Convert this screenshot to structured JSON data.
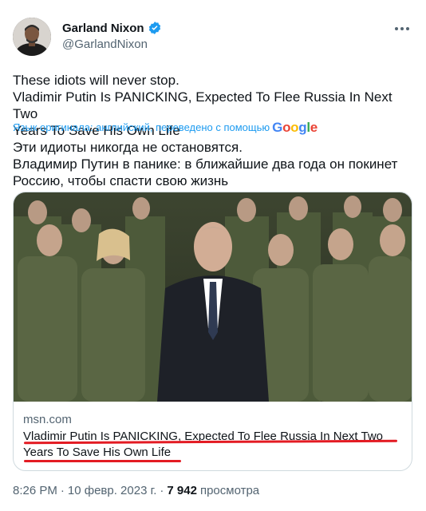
{
  "author": {
    "name": "Garland Nixon",
    "handle": "@GarlandNixon"
  },
  "tweet": {
    "text_line1": "These idiots will never stop.",
    "text_line2": "Vladimir Putin Is PANICKING, Expected To Flee Russia In Next Two",
    "text_line3": "Years To Save His Own Life",
    "translation_note": "Язык оригинала: английский, переведено с помощью",
    "translation_provider": [
      "G",
      "o",
      "o",
      "g",
      "l",
      "e"
    ],
    "translated_line1": "Эти идиоты никогда не остановятся.",
    "translated_line2": "Владимир Путин в панике: в ближайшие два года он покинет",
    "translated_line3": "Россию, чтобы спасти свою жизнь"
  },
  "card": {
    "domain": "msn.com",
    "title_line1": "Vladimir Putin Is PANICKING, Expected To Flee Russia In Next Two",
    "title_line2": "Years To Save His Own Life",
    "image_icon": "news-photo-icon"
  },
  "meta": {
    "time": "8:26 PM",
    "separator1": "·",
    "date": "10 февр. 2023 г.",
    "separator2": "·",
    "views_count": "7 942",
    "views_label": "просмотра"
  },
  "colors": {
    "link_blue": "#1d9bf0",
    "secondary_text": "#536471",
    "primary_text": "#0f1419",
    "annotation_red": "#e31b23",
    "verified_blue": "#1d9bf0"
  }
}
